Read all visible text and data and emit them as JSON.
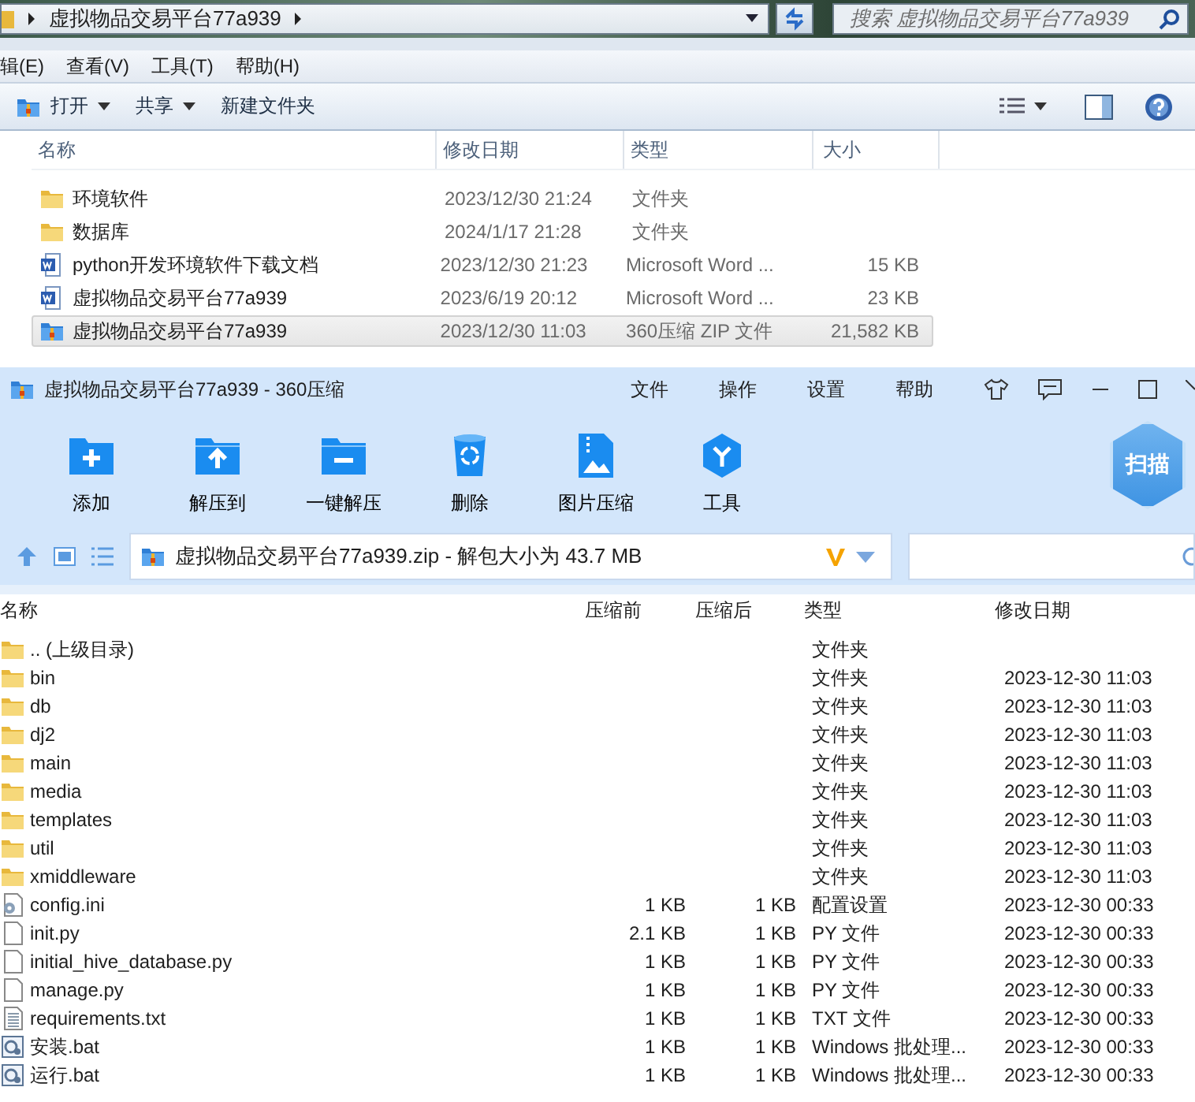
{
  "explorer": {
    "breadcrumb": "虚拟物品交易平台77a939",
    "search_placeholder": "搜索 虚拟物品交易平台77a939",
    "menu": [
      "辑(E)",
      "查看(V)",
      "工具(T)",
      "帮助(H)"
    ],
    "toolbar": [
      {
        "label": "打开",
        "dropdown": true,
        "kind": "zip"
      },
      {
        "label": "共享",
        "dropdown": true,
        "kind": "plain"
      },
      {
        "label": "新建文件夹",
        "dropdown": false,
        "kind": "plain"
      }
    ],
    "columns": [
      "名称",
      "修改日期",
      "类型",
      "大小"
    ],
    "files": [
      {
        "name": "环境软件",
        "modified": "2023/12/30 21:24",
        "type": "文件夹",
        "kind": "folder",
        "selected": false
      },
      {
        "name": "数据库",
        "modified": "2024/1/17 21:28",
        "type": "文件夹",
        "kind": "folder",
        "selected": false
      },
      {
        "name": "python开发环境软件下载文档",
        "modified": "2023/12/30 21:23",
        "type": "Microsoft Word ...",
        "size": "15 KB",
        "kind": "word",
        "selected": false
      },
      {
        "name": "虚拟物品交易平台77a939",
        "modified": "2023/6/19 20:12",
        "type": "Microsoft Word ...",
        "size": "23 KB",
        "kind": "word",
        "selected": false
      },
      {
        "name": "虚拟物品交易平台77a939",
        "modified": "2023/12/30 11:03",
        "type": "360压缩 ZIP 文件",
        "size": "21,582 KB",
        "kind": "zip",
        "selected": true
      }
    ]
  },
  "archive": {
    "title": "虚拟物品交易平台77a939 - 360压缩",
    "menu": [
      "文件",
      "操作",
      "设置",
      "帮助"
    ],
    "tools": [
      {
        "label": "添加",
        "kind": "add"
      },
      {
        "label": "解压到",
        "kind": "extract"
      },
      {
        "label": "一键解压",
        "kind": "oneclick"
      },
      {
        "label": "删除",
        "kind": "delete"
      },
      {
        "label": "图片压缩",
        "kind": "image"
      },
      {
        "label": "工具",
        "kind": "tools"
      }
    ],
    "scan_label": "扫描",
    "path": "虚拟物品交易平台77a939.zip - 解包大小为 43.7 MB",
    "columns": [
      "名称",
      "压缩前",
      "压缩后",
      "类型",
      "修改日期"
    ],
    "files": [
      {
        "name": ".. (上级目录)",
        "type": "文件夹",
        "kind": "folder"
      },
      {
        "name": "bin",
        "type": "文件夹",
        "modified": "2023-12-30 11:03",
        "kind": "folder"
      },
      {
        "name": "db",
        "type": "文件夹",
        "modified": "2023-12-30 11:03",
        "kind": "folder"
      },
      {
        "name": "dj2",
        "type": "文件夹",
        "modified": "2023-12-30 11:03",
        "kind": "folder"
      },
      {
        "name": "main",
        "type": "文件夹",
        "modified": "2023-12-30 11:03",
        "kind": "folder"
      },
      {
        "name": "media",
        "type": "文件夹",
        "modified": "2023-12-30 11:03",
        "kind": "folder"
      },
      {
        "name": "templates",
        "type": "文件夹",
        "modified": "2023-12-30 11:03",
        "kind": "folder"
      },
      {
        "name": "util",
        "type": "文件夹",
        "modified": "2023-12-30 11:03",
        "kind": "folder"
      },
      {
        "name": "xmiddleware",
        "type": "文件夹",
        "modified": "2023-12-30 11:03",
        "kind": "folder"
      },
      {
        "name": "config.ini",
        "before": "1 KB",
        "after": "1 KB",
        "type": "配置设置",
        "modified": "2023-12-30 00:33",
        "kind": "config"
      },
      {
        "name": "init.py",
        "before": "2.1 KB",
        "after": "1 KB",
        "type": "PY 文件",
        "modified": "2023-12-30 00:33",
        "kind": "file"
      },
      {
        "name": "initial_hive_database.py",
        "before": "1 KB",
        "after": "1 KB",
        "type": "PY 文件",
        "modified": "2023-12-30 00:33",
        "kind": "file"
      },
      {
        "name": "manage.py",
        "before": "1 KB",
        "after": "1 KB",
        "type": "PY 文件",
        "modified": "2023-12-30 00:33",
        "kind": "file"
      },
      {
        "name": "requirements.txt",
        "before": "1 KB",
        "after": "1 KB",
        "type": "TXT 文件",
        "modified": "2023-12-30 00:33",
        "kind": "text"
      },
      {
        "name": "安装.bat",
        "before": "1 KB",
        "after": "1 KB",
        "type": "Windows 批处理...",
        "modified": "2023-12-30 00:33",
        "kind": "batch"
      },
      {
        "name": "运行.bat",
        "before": "1 KB",
        "after": "1 KB",
        "type": "Windows 批处理...",
        "modified": "2023-12-30 00:33",
        "kind": "batch"
      }
    ]
  }
}
